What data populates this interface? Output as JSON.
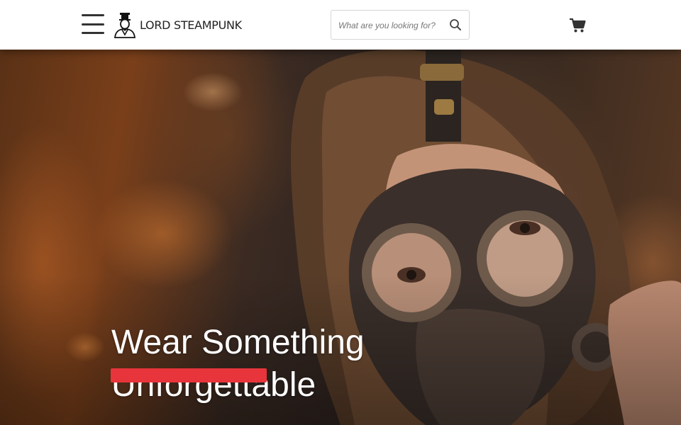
{
  "header": {
    "menu_icon": "hamburger-menu-icon",
    "logo_text": "LORD STEAMPUNK",
    "logo_icon": "top-hat-gentleman-icon",
    "search": {
      "placeholder": "What are you looking for?",
      "value": "",
      "icon": "search-icon"
    },
    "cart_icon": "shopping-cart-icon"
  },
  "hero": {
    "title": "Wear Something\nUnforgettable",
    "cta_color": "#e8343b"
  },
  "colors": {
    "header_bg": "#ffffff",
    "text_dark": "#222222",
    "hero_title": "#ffffff",
    "accent": "#e8343b"
  }
}
